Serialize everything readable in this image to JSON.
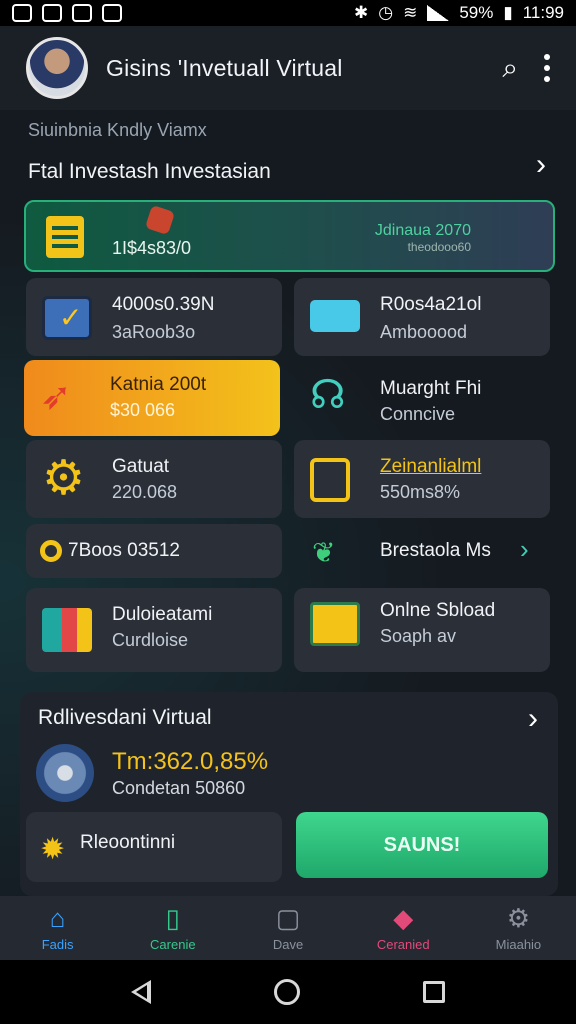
{
  "status_bar": {
    "battery": "59%",
    "time": "11:99"
  },
  "app_bar": {
    "title": "Gisins 'Invetuall Virtual"
  },
  "section": {
    "subtitle": "Siuinbnia Kndly Viamx",
    "title": "Ftal Investash Investasian"
  },
  "hero": {
    "value": "1I$4s83/0",
    "right_line1": "Jdinaua 2070",
    "right_line2": "theodooo60"
  },
  "cards": [
    {
      "title": "4000s0.39N",
      "sub": "3aRoob3o"
    },
    {
      "title": "R0os4a21ol",
      "sub": "Ambooood"
    },
    {
      "title": "Katnia 200t",
      "sub": "$30 066"
    },
    {
      "title": "Muarght Fhi",
      "sub": "Conncive"
    },
    {
      "title": "Gatuat",
      "sub": "220.068"
    },
    {
      "title": "Zeinanlialml",
      "sub": "550ms8%"
    }
  ],
  "strip": {
    "left": "7Boos 03512",
    "right": "Brestaola Ms"
  },
  "cards2": [
    {
      "title": "Duloieatami",
      "sub": "Curdloise"
    },
    {
      "title": "Onlne Sbload",
      "sub": "Soaph av"
    }
  ],
  "panel": {
    "title": "Rdlivesdani Virtual",
    "stat_value": "Tm:362.0,85%",
    "stat_sub": "Condetan 50860",
    "reco_label": "Rleoontinni",
    "cta_label": "SAUNS!"
  },
  "bottom_nav": [
    {
      "label": "Fadis",
      "icon": "home-icon",
      "color": "#3aa3ff"
    },
    {
      "label": "Carenie",
      "icon": "phone-icon",
      "color": "#35c98c"
    },
    {
      "label": "Dave",
      "icon": "square-icon",
      "color": "#8b919b"
    },
    {
      "label": "Ceranied",
      "icon": "chat-icon",
      "color": "#e24a7a"
    },
    {
      "label": "Miaahio",
      "icon": "gear-icon",
      "color": "#8b919b"
    }
  ]
}
